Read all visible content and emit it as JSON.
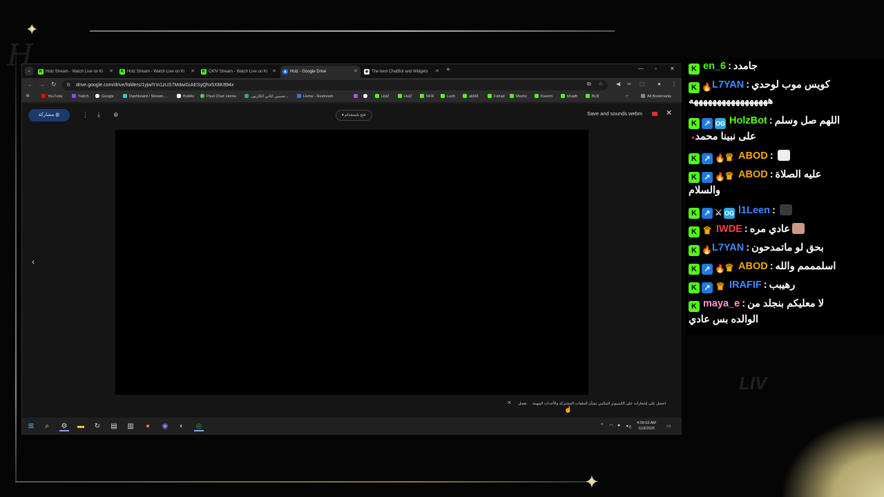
{
  "browser": {
    "tabs": [
      {
        "title": "Holz Stream - Watch Live on Ki",
        "icon": "kick-icon",
        "active": false
      },
      {
        "title": "Holz Stream - Watch Live on Ki",
        "icon": "kick-icon",
        "active": false
      },
      {
        "title": "CKIV Stream - Watch Live on Ki",
        "icon": "kick-icon",
        "active": false
      },
      {
        "title": "Holz - Google Drive",
        "icon": "google-drive-icon",
        "active": true
      },
      {
        "title": "The best ChatBot and Widgets",
        "icon": "botrix-icon",
        "active": false
      }
    ],
    "url": "drive.google.com/drive/folders/1yjwlYm1zUS7MdwiGiAESyQhx5X8K894x",
    "bookmarks": [
      "YouTube",
      "Twitch",
      "Google",
      "Dashboard / Stream...",
      "BotRix",
      "Pixel Chat: Home",
      "تحسين اغاني الكارتون...",
      "Home - Restream",
      "HolZ",
      "HolZ",
      "NFR",
      "Lozh",
      "ak90l",
      "Fahad",
      "Meshz",
      "Kwerm",
      "Muath",
      "BLB"
    ],
    "all_bookmarks": "All Bookmarks"
  },
  "viewer": {
    "share_label": "مشاركة",
    "open_with": "فتح باستخدام",
    "filename": "Save and sounds.webm",
    "notification": "احصل على إشعارات على الكمبيوتر المكتبي بشأن الملفات المشتركة والأحداث المهمة.",
    "notification_action": "تفعيل"
  },
  "taskbar": {
    "time": "4:09:53 AM",
    "date": "11/3/2025",
    "lang": "ع"
  },
  "chat": [
    {
      "badges": [
        "kick"
      ],
      "user": "en_6",
      "color": "#53fc18",
      "message": "جامدد"
    },
    {
      "badges": [
        "kick",
        "fire"
      ],
      "user": "L7YAN",
      "color": "#3d8bff",
      "message": "كويس موب لوحدي",
      "cont": "هههههههههههههههههه"
    },
    {
      "badges": [
        "kick",
        "vip",
        "og"
      ],
      "user": "HolzBot",
      "color": "#53fc18",
      "message": "اللهم صل وسلم",
      "cont": "على نبينا محمد"
    },
    {
      "badges": [
        "kick",
        "vip",
        "fire",
        "crown"
      ],
      "user": "ABOD",
      "color": "#f2a900",
      "message": ""
    },
    {
      "badges": [
        "kick",
        "vip",
        "fire",
        "crown"
      ],
      "user": "ABOD",
      "color": "#f2a900",
      "message": "عليه الصلاة",
      "cont": "والسلام"
    },
    {
      "badges": [
        "kick",
        "vip",
        "sword",
        "og"
      ],
      "user": "l1Leen",
      "color": "#3d8bff",
      "message": ""
    },
    {
      "badges": [
        "kick",
        "crown"
      ],
      "user": "IWDE",
      "color": "#ff3b3b",
      "message": "عادي مره"
    },
    {
      "badges": [
        "kick",
        "fire"
      ],
      "user": "L7YAN",
      "color": "#3d8bff",
      "message": "بحق لو ماتمدحون"
    },
    {
      "badges": [
        "kick",
        "vip",
        "fire",
        "crown"
      ],
      "user": "ABOD",
      "color": "#f2a900",
      "message": "اسلمممم والله"
    },
    {
      "badges": [
        "kick",
        "vip",
        "crown"
      ],
      "user": "IRAFIF",
      "color": "#3d8bff",
      "message": "رهيبب"
    },
    {
      "badges": [
        "kick"
      ],
      "user": "maya_e",
      "color": "#ff9ad5",
      "message": "لا معليكم بنجلد من",
      "cont": "الوالده بس عادي"
    }
  ]
}
